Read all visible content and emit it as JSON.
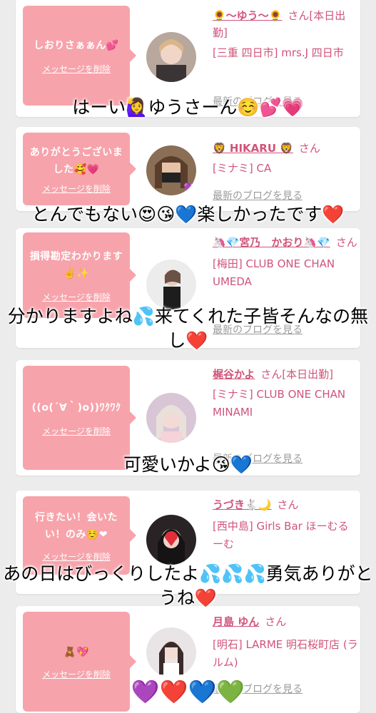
{
  "colors": {
    "bubble": "#f7a3ab",
    "name": "#d0547a",
    "blog_link": "#9a9a9a",
    "background": "#ececec"
  },
  "delete_label": "メッセージを削除",
  "blog_label": "最新のブログを見る",
  "san": "さん",
  "entries": [
    {
      "message": "しおりさぁぁん💕",
      "name": "🌻〜ゆう〜🌻",
      "name_suffix": "さん[本日出勤]",
      "shop": "[三重 四日市] mrs.J 四日市",
      "caption": "はーい🙋‍♀️ゆうさーん☺️💕💗"
    },
    {
      "message": "ありがとうございました🥰💗",
      "name": "🦁 HIKARU 🦁",
      "name_suffix": "さん",
      "shop": "[ミナミ] CA",
      "caption": "とんでもない😍😘💙楽しかったです❤️"
    },
    {
      "message": "損得勘定わかります✌️✨",
      "name": "🦄💎宮乃　かおり🦄💎",
      "name_suffix": "さん",
      "shop": "[梅田] CLUB ONE CHAN UMEDA",
      "caption": "分かりますよね💦来てくれた子皆そんなの無し❤️"
    },
    {
      "message": "((o(´∀｀)o))ﾜｸﾜｸ",
      "name": "梶谷かよ",
      "name_suffix": "さん[本日出勤]",
      "shop": "[ミナミ] CLUB ONE CHAN MINAMI",
      "caption": "可愛いかよ😘💙"
    },
    {
      "message": "行きたい！会いたい！のみ☺️❤",
      "name": "うづき🐇🌙",
      "name_suffix": "さん",
      "shop": "[西中島] Girls Bar ほーむるーむ",
      "caption": "あの日はびっくりしたよ💦💦💦勇気ありがとうね❤️"
    },
    {
      "message": "🧸💖",
      "name": "月島 ゆん",
      "name_suffix": "さん",
      "shop": "[明石] LARME 明石桜町店 (ラルム)",
      "caption": "💜❤️💙💚"
    }
  ]
}
